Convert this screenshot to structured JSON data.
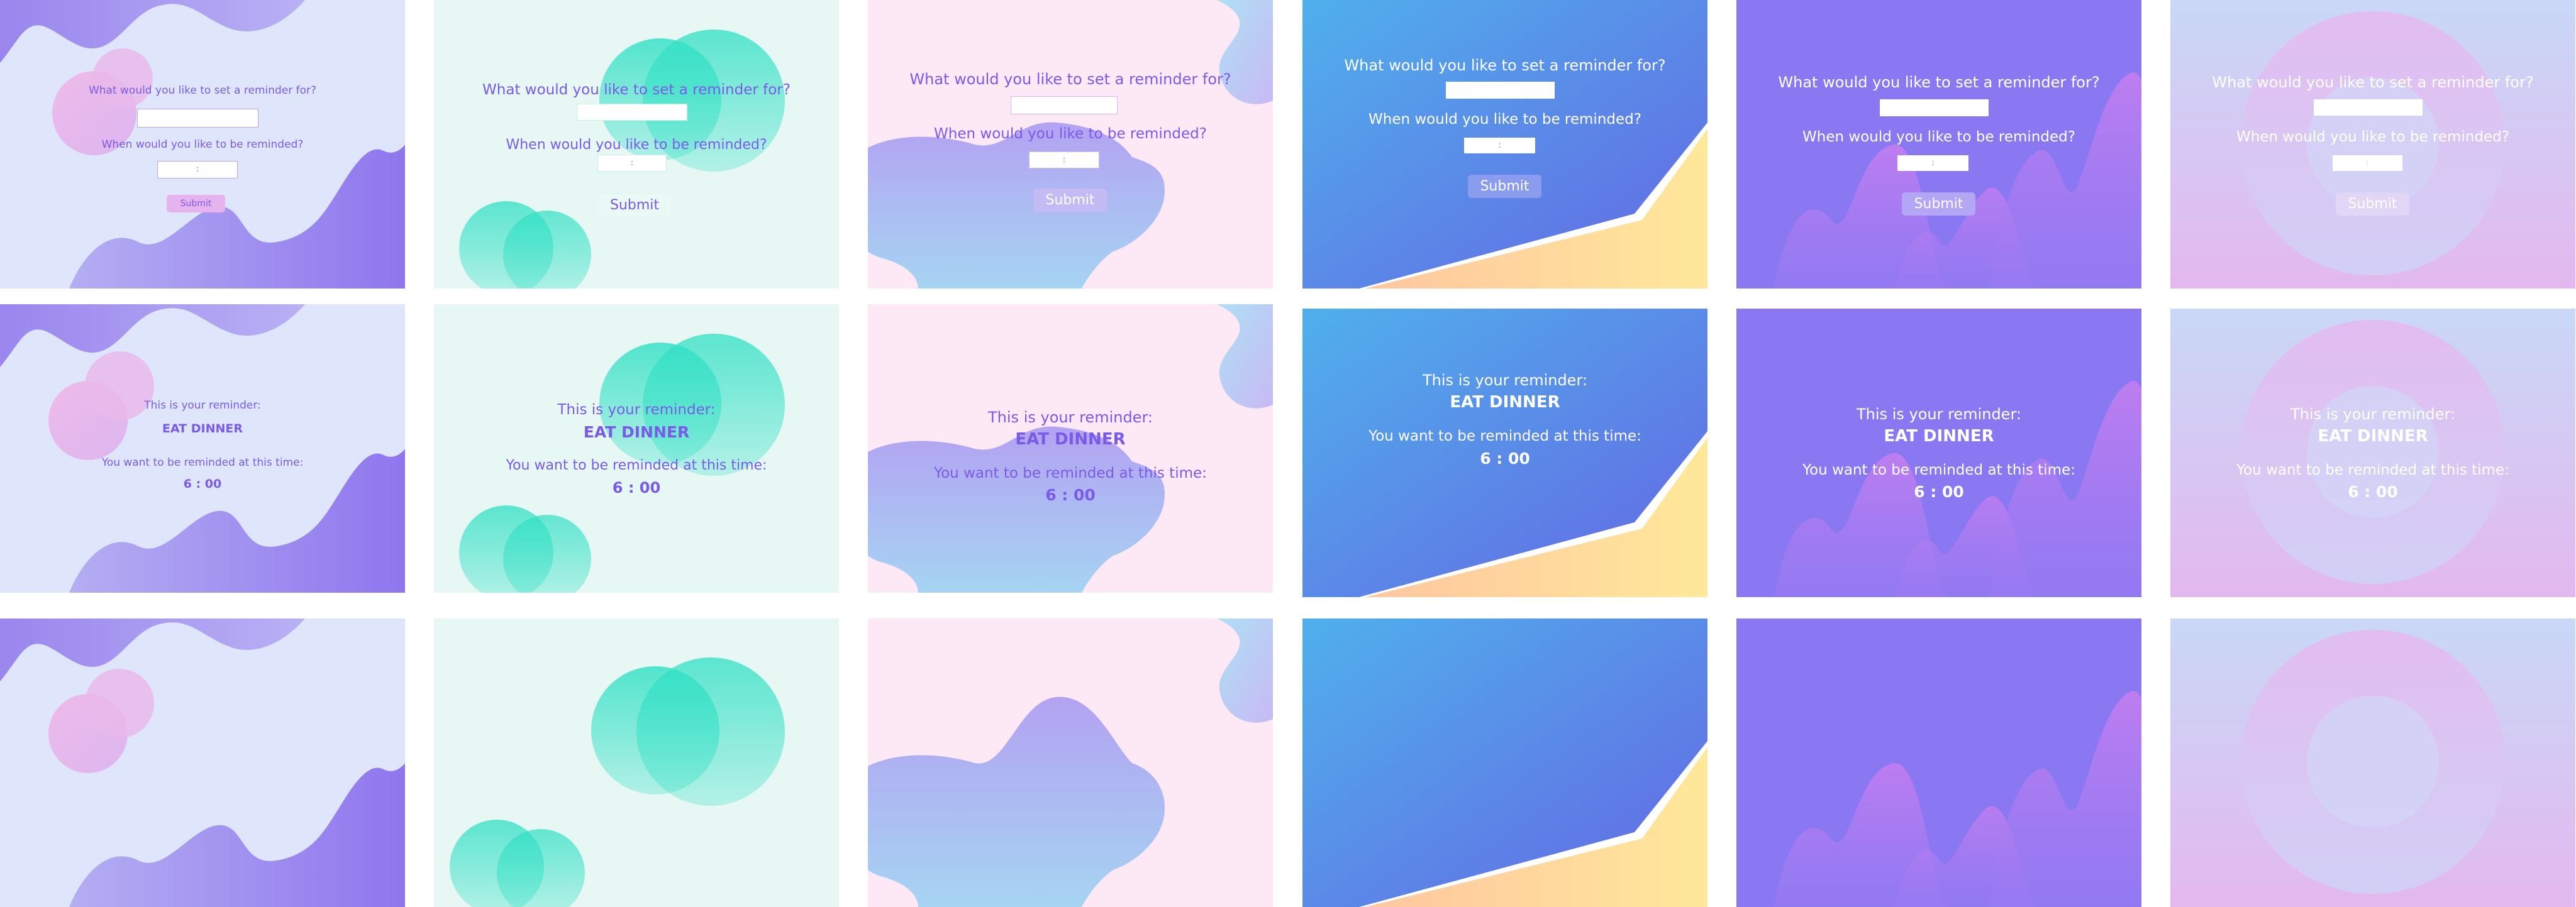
{
  "colors": {
    "lavender_bg": "#dfe6fb",
    "mint_bg": "#e6f7f4",
    "pink_bg": "#fde9f6",
    "blue_grad_start": "#4fb0ec",
    "blue_grad_end": "#6068e4",
    "violet_bg": "#8a78f2",
    "lilac_bg": "#dcc5f2",
    "purple_text": "#7a5be8",
    "teal_blob": "#2fe0c4",
    "white": "#ffffff"
  },
  "form": {
    "question_what": "What would you like to set a reminder for?",
    "question_when": "When would you like to be reminded?",
    "time_separator": ":",
    "submit_label": "Submit"
  },
  "result": {
    "intro": "This is your reminder:",
    "reminder_text": "EAT DINNER",
    "time_intro": "You want to be reminded at this time:",
    "time_value": "6 : 00"
  }
}
